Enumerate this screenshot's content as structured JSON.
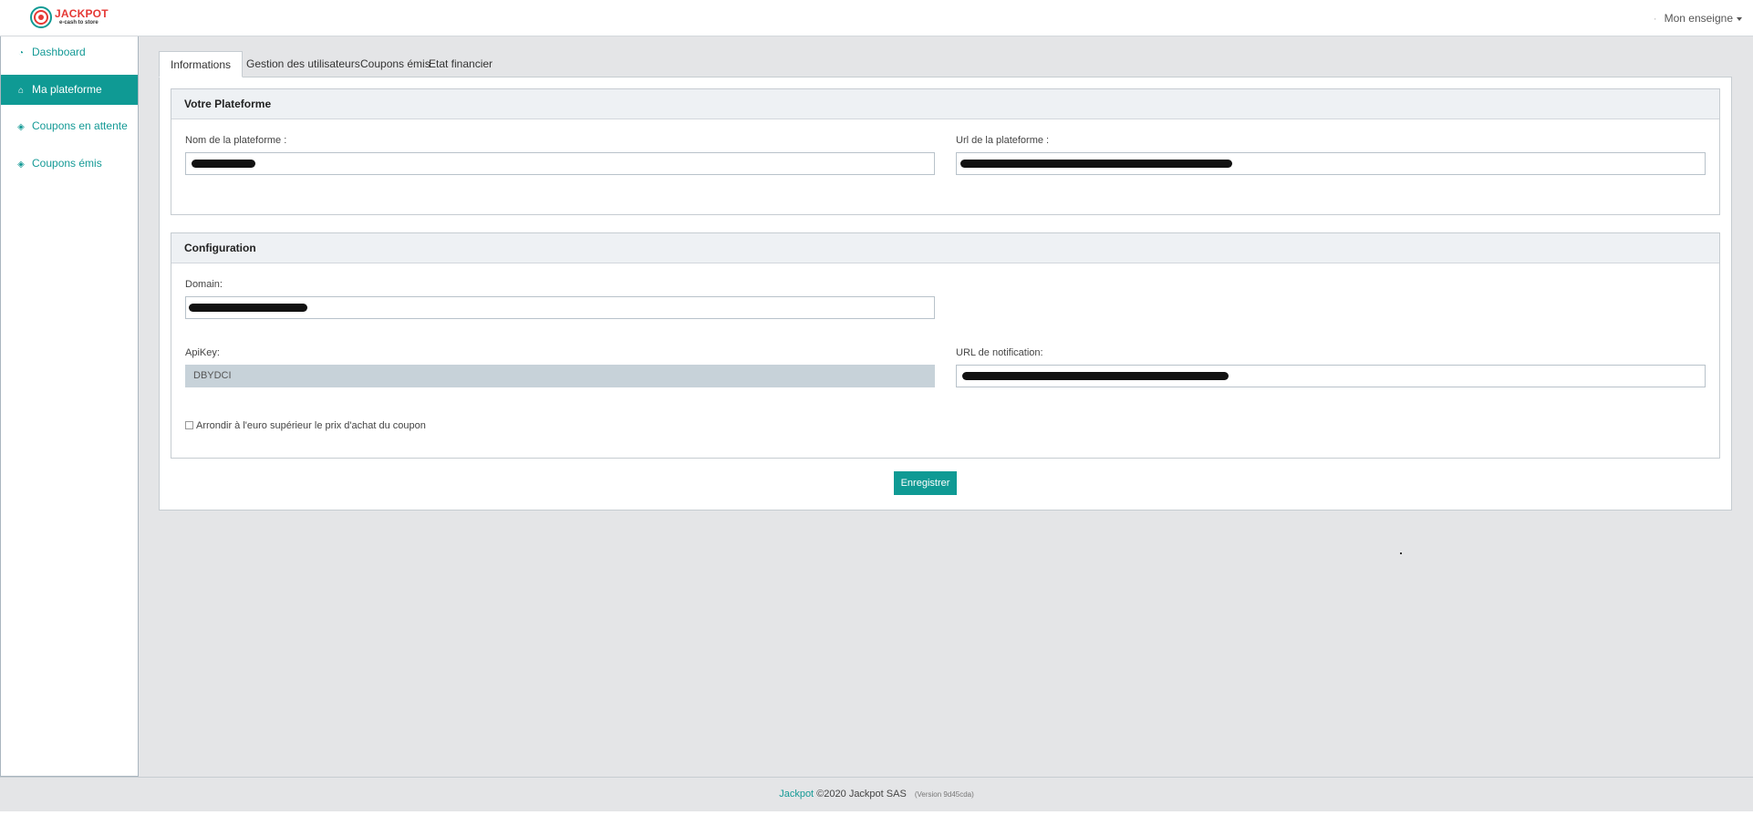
{
  "brand": {
    "logo_title": "JACKPOT",
    "logo_sub": "e-cash to store",
    "accent": "#0f9a94",
    "logo_color": "#e53935"
  },
  "header": {
    "user_menu_label": "Mon enseigne",
    "user_menu_icon": "chevron-down-icon"
  },
  "sidebar": {
    "items": [
      {
        "label": "Dashboard",
        "icon": "tachometer-icon",
        "active": false
      },
      {
        "label": "Ma plateforme",
        "icon": "home-icon",
        "active": true
      },
      {
        "label": "Coupons en attente",
        "icon": "ticket-icon",
        "active": false
      },
      {
        "label": "Coupons émis",
        "icon": "ticket-icon",
        "active": false
      }
    ]
  },
  "tabs": [
    {
      "label": "Informations",
      "active": true
    },
    {
      "label": "Gestion des utilisateurs",
      "active": false
    },
    {
      "label": "Coupons émis",
      "active": false
    },
    {
      "label": "Etat financier",
      "active": false
    }
  ],
  "platform_panel": {
    "title": "Votre Plateforme",
    "name_label": "Nom de la plateforme :",
    "url_label": "Url de la plateforme :"
  },
  "config_panel": {
    "title": "Configuration",
    "domain_label": "Domain:",
    "apikey_label": "ApiKey:",
    "apikey_value": "DBYDCI",
    "notification_label": "URL de notification:",
    "rounding_checkbox_label": "Arrondir à l'euro supérieur le prix d'achat du coupon",
    "rounding_checked": false
  },
  "actions": {
    "save_label": "Enregistrer"
  },
  "footer": {
    "brand": "Jackpot",
    "copyright": "©2020 Jackpot SAS",
    "version": "(Version 9d45cda)"
  }
}
